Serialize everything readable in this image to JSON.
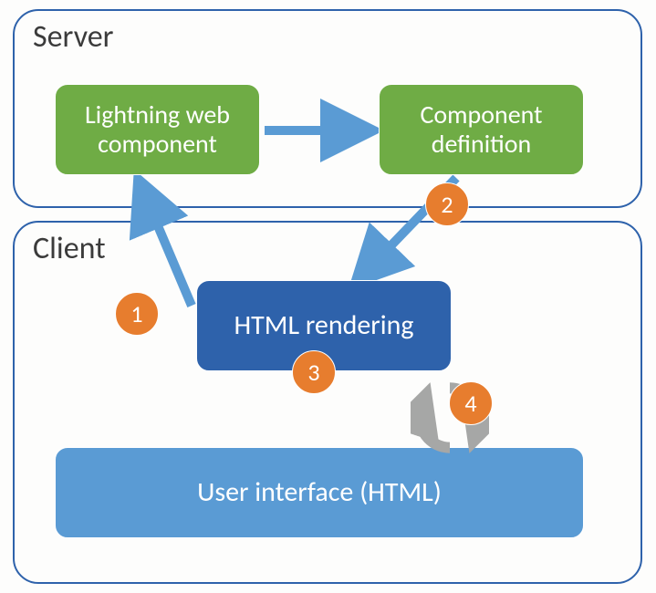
{
  "panels": {
    "server": {
      "title": "Server"
    },
    "client": {
      "title": "Client"
    }
  },
  "boxes": {
    "lwc": {
      "label": "Lightning web\ncomponent"
    },
    "compdef": {
      "label": "Component\ndefinition"
    },
    "rendering": {
      "label": "HTML rendering"
    },
    "ui": {
      "label": "User interface (HTML)"
    }
  },
  "badges": {
    "b1": "1",
    "b2": "2",
    "b3": "3",
    "b4": "4"
  },
  "arrows": {
    "a_lwc_to_def": {
      "from": "lwc",
      "to": "compdef"
    },
    "a_def_to_render": {
      "from": "compdef",
      "to": "rendering",
      "badge": "b2"
    },
    "a_render_to_lwc": {
      "from": "rendering",
      "to": "lwc",
      "badge": "b1"
    },
    "a_cycle": {
      "between": [
        "rendering",
        "ui"
      ],
      "badge": "b4"
    }
  },
  "colors": {
    "panel_border": "#2e62ab",
    "green": "#6fac45",
    "darkblue": "#2e62ab",
    "lightblue": "#5a9bd4",
    "badge": "#e77d2e",
    "arrow": "#5a9bd4",
    "cycle": "#a6a7a6"
  }
}
